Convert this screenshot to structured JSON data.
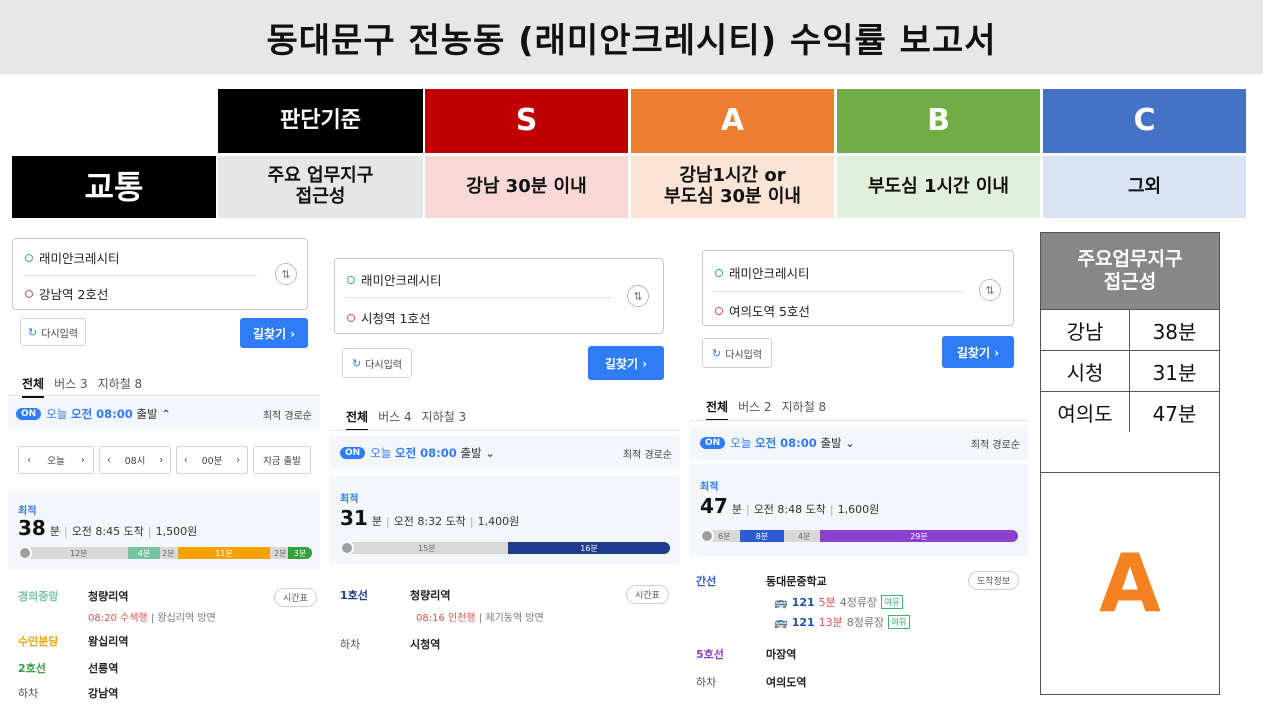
{
  "report": {
    "title": "동대문구 전농동 (래미안크레시티) 수익률 보고서"
  },
  "grades": {
    "header": {
      "criteria": "판단기준",
      "s": "S",
      "a": "A",
      "b": "B",
      "c": "C"
    },
    "row": {
      "category": "교통",
      "criteria": "주요 업무지구\n접근성",
      "s": "강남 30분 이내",
      "a": "강남1시간 or\n부도심 30분 이내",
      "b": "부도심 1시간 이내",
      "c": "그외"
    },
    "colors": {
      "criteria": "#000000",
      "s": "#c00000",
      "a": "#ed7d31",
      "b": "#70ad47",
      "c": "#4472c4"
    }
  },
  "routes": [
    {
      "from": "래미안크레시티",
      "to": "강남역 2호선",
      "reset_label": "다시입력",
      "search_label": "길찾기 ›",
      "tabs": [
        "전체",
        "버스 3",
        "지하철 8"
      ],
      "depart": {
        "on": "ON",
        "day": "오늘",
        "time": "오전 08:00",
        "suffix": "출발",
        "sort": "최적 경로순"
      },
      "timepick": {
        "day": "오늘",
        "hour": "08시",
        "min": "00분",
        "now": "지금 출발"
      },
      "best_label": "최적",
      "minutes": "38",
      "unit": "분",
      "arrive": "오전 8:45 도착",
      "fare": "1,500원",
      "segments": {
        "walk1": "12분",
        "sub1": "4분",
        "walk2": "2분",
        "sub2": "11분",
        "walk3": "2분",
        "sub3": "3분"
      },
      "steps": [
        {
          "line": "경의중앙",
          "station": "청량리역",
          "color": "#77c4a3"
        },
        {
          "line": "수인분당",
          "station": "왕십리역",
          "color": "#f5a200"
        },
        {
          "line": "2호선",
          "station": "선릉역",
          "color": "#33a23d"
        }
      ],
      "step1_sub": {
        "time": "08:20",
        "dir": "수색행",
        "extra": "왕십리역 방면"
      },
      "timetable": "시간표",
      "exit": {
        "label": "하차",
        "station": "강남역"
      }
    },
    {
      "from": "래미안크레시티",
      "to": "시청역 1호선",
      "reset_label": "다시입력",
      "search_label": "길찾기 ›",
      "tabs": [
        "전체",
        "버스 4",
        "지하철 3"
      ],
      "depart": {
        "on": "ON",
        "day": "오늘",
        "time": "오전 08:00",
        "suffix": "출발",
        "sort": "최적 경로순"
      },
      "best_label": "최적",
      "minutes": "31",
      "unit": "분",
      "arrive": "오전 8:32 도착",
      "fare": "1,400원",
      "segments": {
        "walk1": "15분",
        "sub1": "16분"
      },
      "steps": [
        {
          "line": "1호선",
          "station": "청량리역",
          "color": "#1f3b8f"
        }
      ],
      "step1_sub": {
        "time": "08:16",
        "dir": "인천행",
        "extra": "제기동역 방면"
      },
      "timetable": "시간표",
      "exit": {
        "label": "하차",
        "station": "시청역"
      }
    },
    {
      "from": "래미안크레시티",
      "to": "여의도역 5호선",
      "reset_label": "다시입력",
      "search_label": "길찾기 ›",
      "tabs": [
        "전체",
        "버스 2",
        "지하철 8"
      ],
      "depart": {
        "on": "ON",
        "day": "오늘",
        "time": "오전 08:00",
        "suffix": "출발",
        "sort": "최적 경로순"
      },
      "best_label": "최적",
      "minutes": "47",
      "unit": "분",
      "arrive": "오전 8:48 도착",
      "fare": "1,600원",
      "segments": {
        "walk1": "6분",
        "bus1": "8분",
        "walk2": "4분",
        "sub1": "29분"
      },
      "steps": [
        {
          "line": "간선",
          "station": "동대문중학교",
          "color": "#2f5bd5"
        },
        {
          "line": "5호선",
          "station": "마장역",
          "color": "#8b3fd1"
        }
      ],
      "bus1": {
        "no": "121",
        "min": "5분",
        "stops": "4정류장",
        "tag": "여유"
      },
      "bus2": {
        "no": "121",
        "min": "13분",
        "stops": "8정류장",
        "tag": "여유"
      },
      "stopinfo": "도착정보",
      "exit": {
        "label": "하차",
        "station": "여의도역"
      }
    }
  ],
  "summary": {
    "header": "주요업무지구\n접근성",
    "rows": [
      {
        "place": "강남",
        "time": "38분"
      },
      {
        "place": "시청",
        "time": "31분"
      },
      {
        "place": "여의도",
        "time": "47분"
      }
    ],
    "grade": "A",
    "grade_color": "#f58220"
  }
}
